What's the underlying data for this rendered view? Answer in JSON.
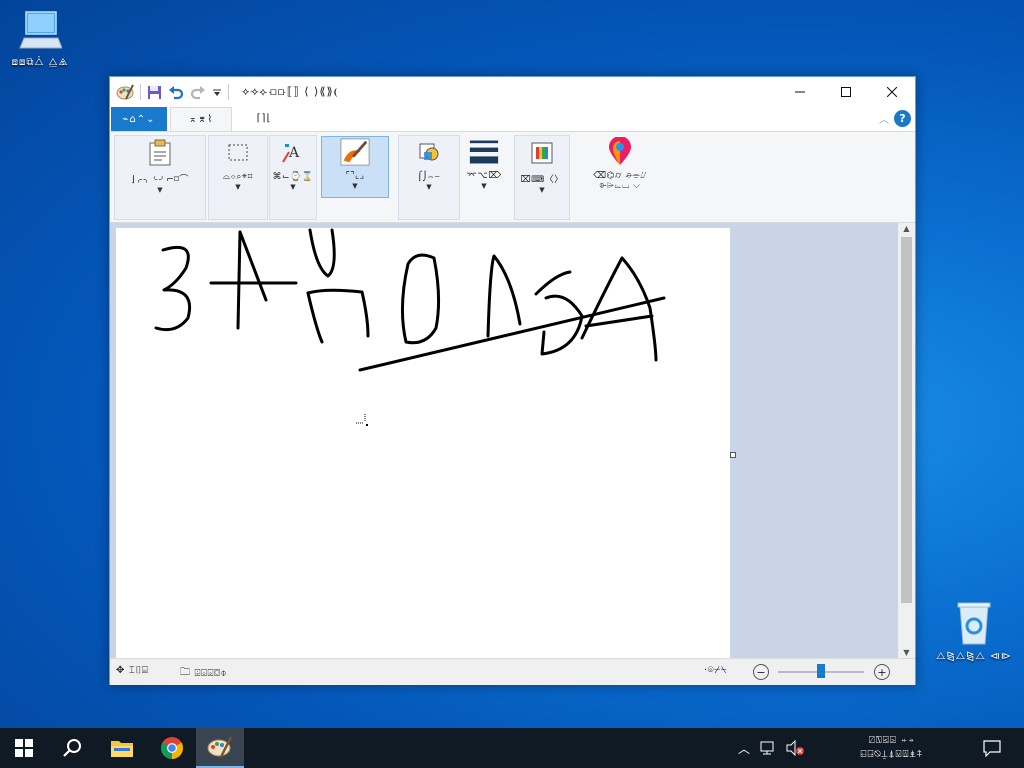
{
  "desktop": {
    "this_pc_label": "⧈⧈⧉⧊ ⧋⧌",
    "recycle_bin_label": "⧍⧎⧍⧎⧍ ⧏⧐"
  },
  "window": {
    "title": "⟡⟢⟣⟤⟥⟦⟧ ⟨ ⟩⟪⟫⟬",
    "tabs": {
      "file": "⌁⌂⌃⌄",
      "home": "⌅⌆⌇",
      "view": "⌈⌉⌊"
    },
    "ribbon": {
      "clipboard": "⌋⌌⌍⌎⌏⌐⌑⌒",
      "image": "⌓⌔⌕⌖⌗",
      "tools": "⌘⌙⌚⌛",
      "brushes": "⌜⌝⌞⌟",
      "shapes": "⌠⌡⌢⌣",
      "size": "⌤⌥⌦",
      "colors": "⌧⌨〈〉",
      "edit_paint3d_line1": "⌫⌬⌭ ⌮⌯⌰",
      "edit_paint3d_line2": "⌱⌲⌳⌴ ⌵"
    },
    "status": {
      "size_text": "⌶⌷⌸",
      "selection_text": "⌹⌺⌻⌼⌽"
    },
    "zoom": {
      "label": "·⌾⌿⍀",
      "level_fraction": 0.5
    }
  },
  "taskbar": {
    "clock_line1": "⍁⍂⍃⍄ ⍅⍆",
    "clock_line2": "⍇⍈⍉⍊⍋⍌⍍⍎⍏"
  }
}
